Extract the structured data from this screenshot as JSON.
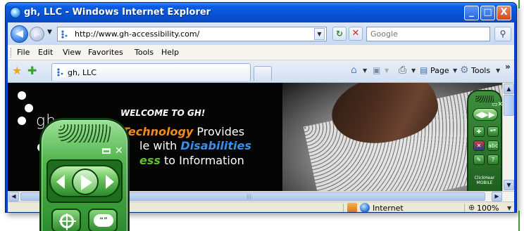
{
  "window": {
    "title": "gh, LLC - Windows Internet Explorer",
    "minimize_glyph": "_",
    "maximize_glyph": "□",
    "close_glyph": "X"
  },
  "address_bar": {
    "url": "http://www.gh-accessibility.com/",
    "search_placeholder": "Google"
  },
  "menu": {
    "items": [
      "File",
      "Edit",
      "View",
      "Favorites",
      "Tools",
      "Help"
    ]
  },
  "tab": {
    "label": "gh, LLC"
  },
  "command_bar": {
    "page_label": "Page",
    "tools_label": "Tools"
  },
  "page": {
    "logo_text": "gh",
    "welcome": "WELCOME TO GH!",
    "tagline_1_em": "Technology",
    "tagline_1_rest": " Provides",
    "tagline_2_pre": "le with ",
    "tagline_2_em": "Disabilities",
    "tagline_3_em": "ess",
    "tagline_3_rest": " to Information"
  },
  "mini_toolbar": {
    "abc_label": "abc",
    "help_label": "?",
    "caption_1": "ClickHear",
    "caption_2": "MOBILE"
  },
  "status_bar": {
    "zone": "Internet",
    "zoom": "100%"
  },
  "big_toolbar": {
    "speech_bubble": "“”"
  },
  "colors": {
    "title_bar": "#0b5de4",
    "tagline_orange": "#f28a1c",
    "tagline_blue": "#3a8fe8",
    "tagline_green": "#5fbf2f",
    "toolbar_green": "#2b8a2b"
  }
}
